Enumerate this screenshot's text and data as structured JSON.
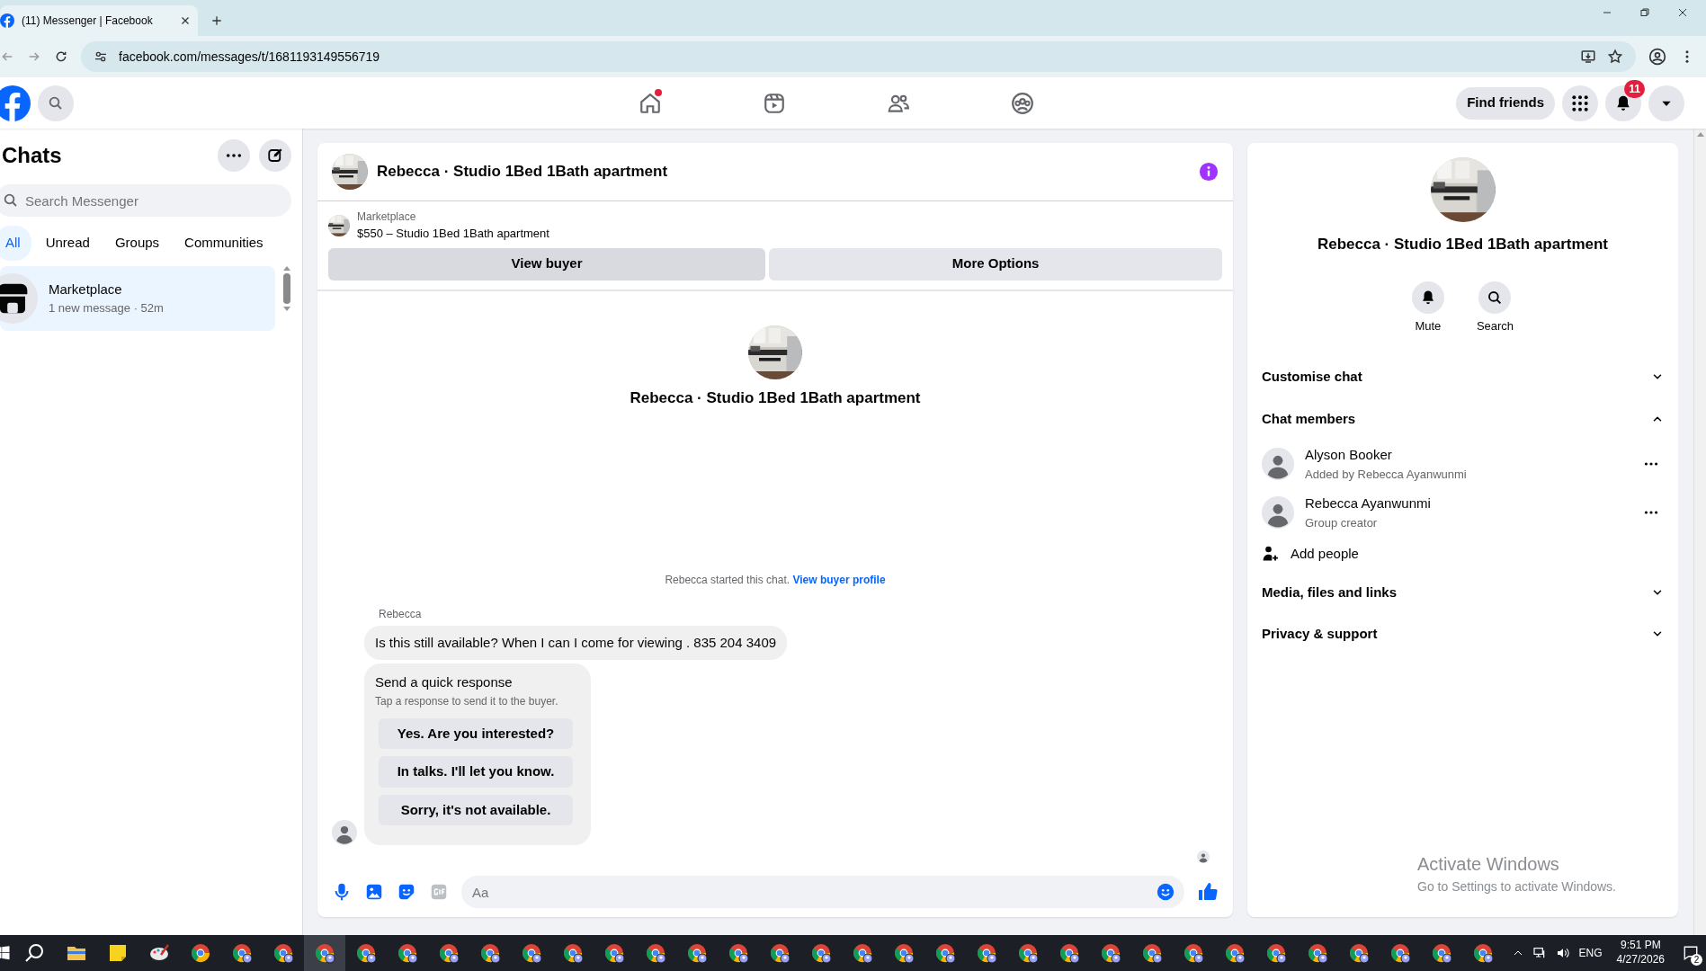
{
  "browser": {
    "tab_title": "(11) Messenger | Facebook",
    "url": "facebook.com/messages/t/1681193149556719"
  },
  "topbar": {
    "nav": [
      {
        "kind": "home",
        "notification_dot": true
      },
      {
        "kind": "video",
        "notification_dot": false
      },
      {
        "kind": "friends",
        "notification_dot": false
      },
      {
        "kind": "groups",
        "notification_dot": false
      }
    ],
    "find_friends": "Find friends",
    "notifications_badge": "11"
  },
  "sidebar": {
    "title": "Chats",
    "search": {
      "placeholder": "Search Messenger"
    },
    "filters": [
      {
        "label": "All",
        "selected": true
      },
      {
        "label": "Unread",
        "selected": false
      },
      {
        "label": "Groups",
        "selected": false
      },
      {
        "label": "Communities",
        "selected": false
      }
    ],
    "chats": [
      {
        "name": "Marketplace",
        "preview": "1 new message · 52m",
        "selected": true
      }
    ]
  },
  "conversation": {
    "title": "Rebecca · Studio 1Bed 1Bath apartment",
    "listing": {
      "source": "Marketplace",
      "title": "$550 – Studio 1Bed 1Bath apartment",
      "buttons": [
        "View buyer",
        "More Options"
      ]
    },
    "intro_title": "Rebecca · Studio 1Bed 1Bath apartment",
    "started_note": "Rebecca started this chat.",
    "started_link": "View buyer profile",
    "messages": [
      {
        "sender": "Rebecca",
        "text": "Is this still available? When I can I come for viewing . 835 204 3409"
      }
    ],
    "quick_response": {
      "title": "Send a quick response",
      "subtitle": "Tap a response to send it to the buyer.",
      "options": [
        "Yes. Are you interested?",
        "In talks. I'll let you know.",
        "Sorry, it's not available."
      ]
    },
    "composer": {
      "placeholder": "Aa"
    }
  },
  "details": {
    "title": "Rebecca · Studio 1Bed 1Bath apartment",
    "actions": [
      {
        "kind": "mute",
        "label": "Mute"
      },
      {
        "kind": "search",
        "label": "Search"
      }
    ],
    "sections": [
      {
        "label": "Customise chat",
        "expanded": false
      },
      {
        "label": "Chat members",
        "expanded": true,
        "members": [
          {
            "name": "Alyson Booker",
            "note": "Added by Rebecca Ayanwunmi"
          },
          {
            "name": "Rebecca Ayanwunmi",
            "note": "Group creator"
          }
        ],
        "add_label": "Add people"
      },
      {
        "label": "Media, files and links",
        "expanded": false
      },
      {
        "label": "Privacy & support",
        "expanded": false
      }
    ]
  },
  "activation_notice": {
    "title": "Activate Windows",
    "text": "Go to Settings to activate Windows."
  },
  "taskbar": {
    "apps": [
      {
        "kind": "search",
        "selected": false
      },
      {
        "kind": "explorer",
        "selected": false
      },
      {
        "kind": "notes",
        "selected": false
      },
      {
        "kind": "paint",
        "selected": false
      },
      {
        "kind": "chrome",
        "selected": false
      },
      {
        "kind": "chrome-profile",
        "selected": false
      },
      {
        "kind": "chrome-profile",
        "selected": false
      },
      {
        "kind": "chrome-profile",
        "selected": true
      },
      {
        "kind": "chrome-profile",
        "selected": false
      },
      {
        "kind": "chrome-profile",
        "selected": false
      },
      {
        "kind": "chrome-profile",
        "selected": false
      },
      {
        "kind": "chrome-profile",
        "selected": false
      },
      {
        "kind": "chrome-profile",
        "selected": false
      },
      {
        "kind": "chrome-profile",
        "selected": false
      },
      {
        "kind": "chrome-profile",
        "selected": false
      },
      {
        "kind": "chrome-profile",
        "selected": false
      },
      {
        "kind": "chrome-profile",
        "selected": false
      },
      {
        "kind": "chrome-profile",
        "selected": false
      },
      {
        "kind": "chrome-profile",
        "selected": false
      },
      {
        "kind": "chrome-profile",
        "selected": false
      },
      {
        "kind": "chrome-profile",
        "selected": false
      },
      {
        "kind": "chrome-profile",
        "selected": false
      },
      {
        "kind": "chrome-profile",
        "selected": false
      },
      {
        "kind": "chrome-profile",
        "selected": false
      },
      {
        "kind": "chrome-profile",
        "selected": false
      },
      {
        "kind": "chrome-profile",
        "selected": false
      },
      {
        "kind": "chrome-profile",
        "selected": false
      },
      {
        "kind": "chrome-profile",
        "selected": false
      },
      {
        "kind": "chrome-profile",
        "selected": false
      },
      {
        "kind": "chrome-profile",
        "selected": false
      },
      {
        "kind": "chrome-profile",
        "selected": false
      },
      {
        "kind": "chrome-profile",
        "selected": false
      },
      {
        "kind": "chrome-profile",
        "selected": false
      },
      {
        "kind": "chrome-profile",
        "selected": false
      },
      {
        "kind": "chrome-profile",
        "selected": false
      },
      {
        "kind": "chrome-profile",
        "selected": false
      }
    ],
    "language": "ENG",
    "time": "9:51 PM",
    "date": "4/27/2026",
    "notification_count": "2"
  }
}
